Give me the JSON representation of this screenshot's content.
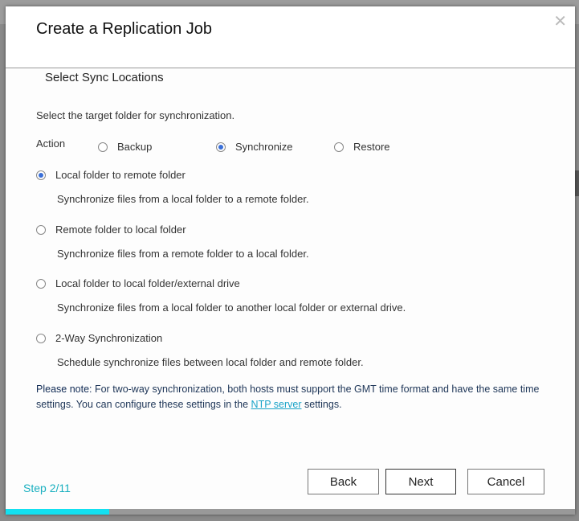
{
  "dialog": {
    "title": "Create a Replication Job",
    "close_icon": "close-x-icon",
    "section_title": "Select Sync Locations",
    "instruction": "Select the target folder for synchronization.",
    "action": {
      "label": "Action",
      "options": [
        {
          "label": "Backup",
          "selected": false
        },
        {
          "label": "Synchronize",
          "selected": true
        },
        {
          "label": "Restore",
          "selected": false
        }
      ]
    },
    "modes": [
      {
        "label": "Local folder to remote folder",
        "description": "Synchronize files from a local folder to a remote folder.",
        "selected": true
      },
      {
        "label": "Remote folder to local folder",
        "description": "Synchronize files from a remote folder to a local folder.",
        "selected": false
      },
      {
        "label": "Local folder to local folder/external drive",
        "description": "Synchronize files from a local folder to another local folder or external drive.",
        "selected": false
      },
      {
        "label": "2-Way Synchronization",
        "description": "Schedule synchronize files between local folder and remote folder.",
        "selected": false
      }
    ],
    "note": {
      "prefix": "Please note:",
      "text": " For two-way synchronization, both hosts must support the GMT time format and have the same time settings. You can configure these settings in the ",
      "link": "NTP server",
      "suffix": " settings."
    },
    "buttons": {
      "back": "Back",
      "next": "Next",
      "cancel": "Cancel"
    },
    "step": "Step 2/11",
    "progress_percent": 18.2,
    "accent_color": "#13e0f0"
  }
}
